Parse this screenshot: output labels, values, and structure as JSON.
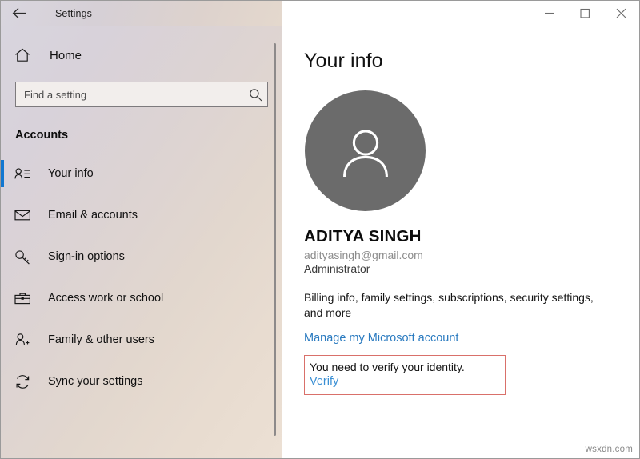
{
  "window": {
    "title": "Settings",
    "back_icon": "back-arrow-icon",
    "controls": {
      "minimize": "minimize-icon",
      "maximize": "maximize-icon",
      "close": "close-icon"
    }
  },
  "sidebar": {
    "home": {
      "label": "Home",
      "icon": "home-icon"
    },
    "search": {
      "placeholder": "Find a setting",
      "value": "",
      "icon": "search-icon"
    },
    "section_title": "Accounts",
    "items": [
      {
        "label": "Your info",
        "icon": "user-card-icon",
        "selected": true
      },
      {
        "label": "Email & accounts",
        "icon": "envelope-icon",
        "selected": false
      },
      {
        "label": "Sign-in options",
        "icon": "key-icon",
        "selected": false
      },
      {
        "label": "Access work or school",
        "icon": "briefcase-icon",
        "selected": false
      },
      {
        "label": "Family & other users",
        "icon": "user-add-icon",
        "selected": false
      },
      {
        "label": "Sync your settings",
        "icon": "sync-icon",
        "selected": false
      }
    ]
  },
  "main": {
    "page_title": "Your info",
    "avatar_icon": "person-avatar-icon",
    "user_name": "ADITYA SINGH",
    "user_email": "adityasingh@gmail.com",
    "user_role": "Administrator",
    "billing_text": "Billing info, family settings, subscriptions, security settings, and more",
    "manage_link": "Manage my Microsoft account",
    "verify": {
      "message": "You need to verify your identity.",
      "link": "Verify"
    }
  },
  "watermark": "wsxdn.com",
  "colors": {
    "accent_blue": "#1177d1",
    "link_blue": "#2b7bc0",
    "verify_link_blue": "#3a8fd4",
    "verify_border_red": "#d9706a",
    "avatar_gray": "#6b6b6b"
  }
}
